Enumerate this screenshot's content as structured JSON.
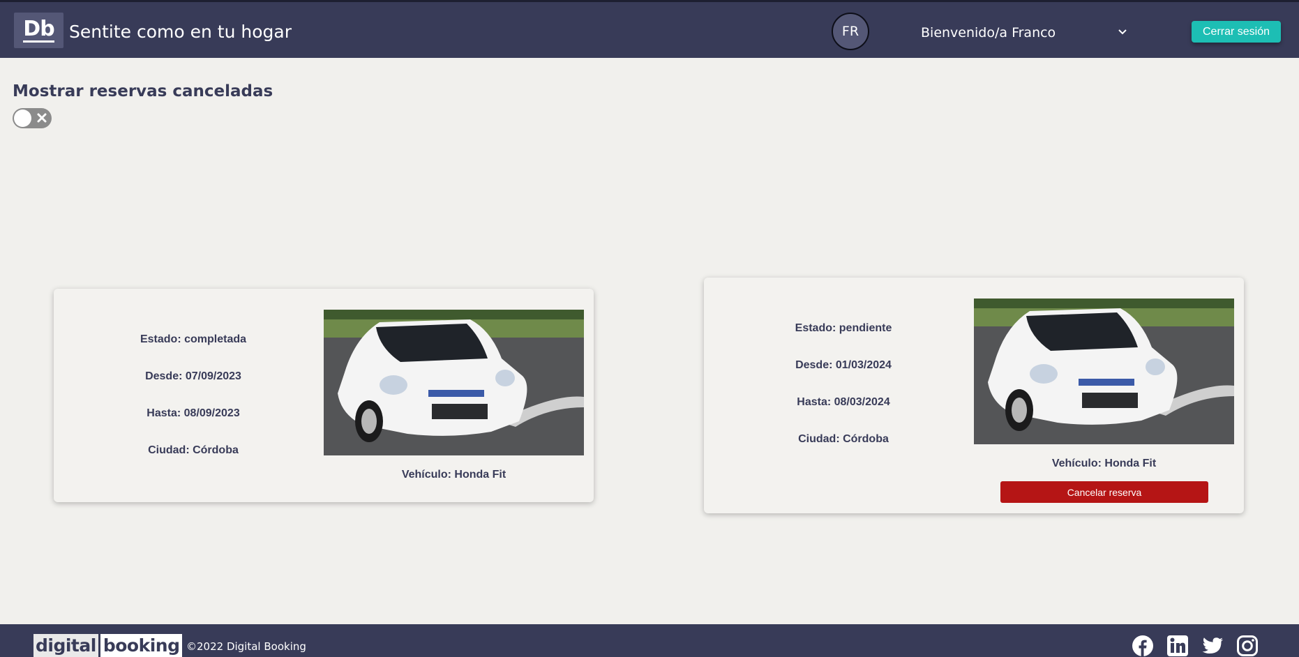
{
  "header": {
    "logo_text": "Db",
    "slogan": "Sentite como en tu hogar",
    "avatar_initials": "FR",
    "welcome": "Bienvenido/a Franco",
    "logout_label": "Cerrar sesión"
  },
  "toggle": {
    "title": "Mostrar reservas canceladas",
    "state": "off"
  },
  "reservations": [
    {
      "estado": "Estado: completada",
      "desde": "Desde: 07/09/2023",
      "hasta": "Hasta: 08/09/2023",
      "ciudad": "Ciudad: Córdoba",
      "vehiculo": "Vehículo: Honda Fit"
    },
    {
      "estado": "Estado: pendiente",
      "desde": "Desde: 01/03/2024",
      "hasta": "Hasta: 08/03/2024",
      "ciudad": "Ciudad: Córdoba",
      "vehiculo": "Vehículo: Honda Fit",
      "cancel_label": "Cancelar reserva"
    }
  ],
  "footer": {
    "logo_part1": "digital",
    "logo_part2": "booking",
    "copyright": "©2022 Digital Booking",
    "social_icons": [
      "facebook-icon",
      "linkedin-icon",
      "twitter-icon",
      "instagram-icon"
    ]
  },
  "colors": {
    "header_bg": "#383b58",
    "accent": "#1dbeb4",
    "danger": "#b51515",
    "page_bg": "#f1f0ed"
  }
}
